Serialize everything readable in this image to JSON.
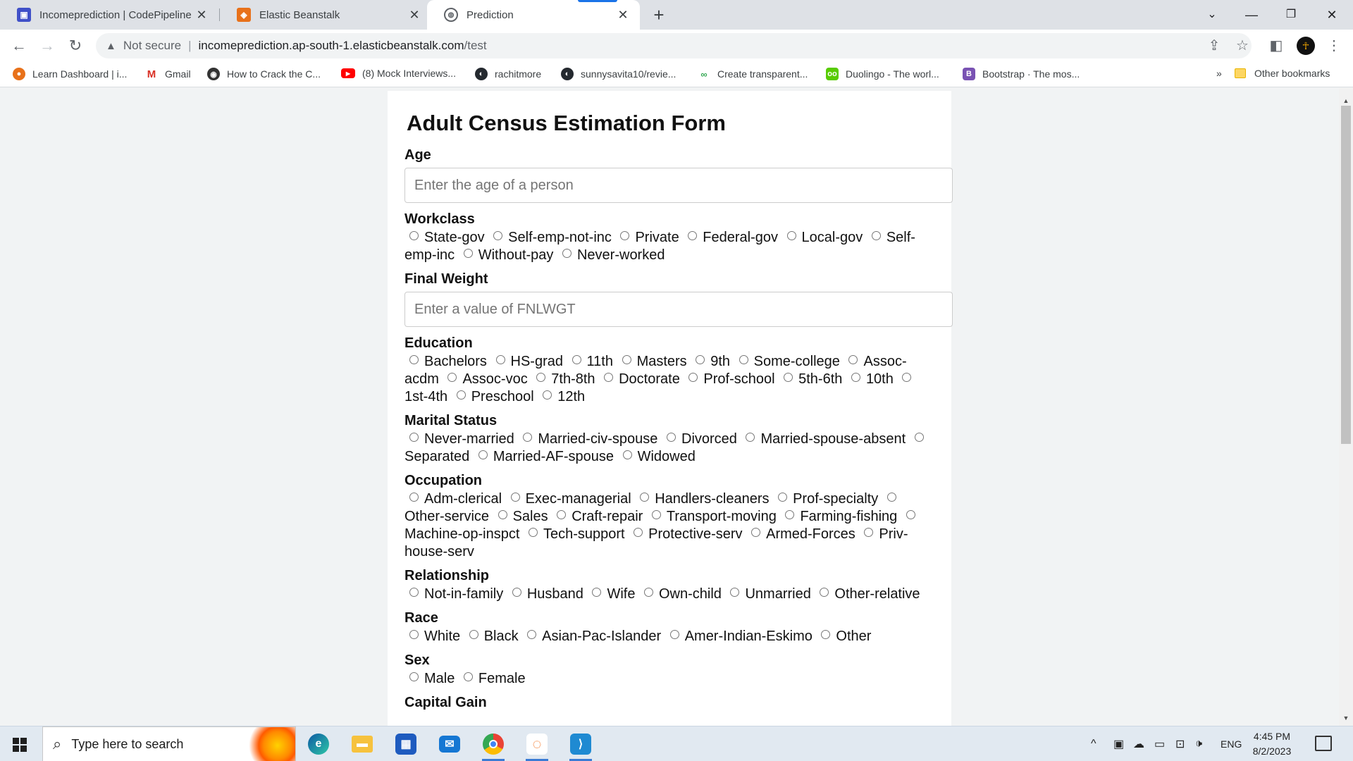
{
  "browser": {
    "tabs": [
      {
        "title": "Incomeprediction | CodePipeline",
        "icon": "codepipeline-icon",
        "color": "#4050c8"
      },
      {
        "title": "Elastic Beanstalk",
        "icon": "aws-icon",
        "color": "#e8711a"
      },
      {
        "title": "Prediction",
        "icon": "globe-icon",
        "color": "#5f6368"
      }
    ],
    "address": {
      "security": "Not secure",
      "host": "incomeprediction.ap-south-1.elasticbeanstalk.com",
      "path": "/test"
    },
    "bookmarks": [
      {
        "label": "Learn Dashboard | i...",
        "icon": "learn-icon",
        "color": "#e8711a"
      },
      {
        "label": "Gmail",
        "icon": "gmail-icon",
        "color": "#d93025"
      },
      {
        "label": "How to Crack the C...",
        "icon": "site-icon",
        "color": "#333333"
      },
      {
        "label": "(8) Mock Interviews...",
        "icon": "youtube-icon",
        "color": "#ff0000"
      },
      {
        "label": "rachitmore",
        "icon": "github-icon",
        "color": "#24292f"
      },
      {
        "label": "sunnysavita10/revie...",
        "icon": "github-icon",
        "color": "#24292f"
      },
      {
        "label": "Create transparent...",
        "icon": "link-icon",
        "color": "#34a853"
      },
      {
        "label": "Duolingo - The worl...",
        "icon": "duolingo-icon",
        "color": "#58cc02"
      },
      {
        "label": "Bootstrap · The mos...",
        "icon": "bootstrap-icon",
        "color": "#7952b3"
      }
    ],
    "overflow": "»",
    "other_bookmarks": "Other bookmarks"
  },
  "form": {
    "title": "Adult Census Estimation Form",
    "age_label": "Age",
    "age_placeholder": "Enter the age of a person",
    "workclass_label": "Workclass",
    "workclass_options": [
      "State-gov",
      "Self-emp-not-inc",
      "Private",
      "Federal-gov",
      "Local-gov",
      "Self-emp-inc",
      "Without-pay",
      "Never-worked"
    ],
    "fnlwgt_label": "Final Weight",
    "fnlwgt_placeholder": "Enter a value of FNLWGT",
    "education_label": "Education",
    "education_options": [
      "Bachelors",
      "HS-grad",
      "11th",
      "Masters",
      "9th",
      "Some-college",
      "Assoc-acdm",
      "Assoc-voc",
      "7th-8th",
      "Doctorate",
      "Prof-school",
      "5th-6th",
      "10th",
      "1st-4th",
      "Preschool",
      "12th"
    ],
    "marital_label": "Marital Status",
    "marital_options": [
      "Never-married",
      "Married-civ-spouse",
      "Divorced",
      "Married-spouse-absent",
      "Separated",
      "Married-AF-spouse",
      "Widowed"
    ],
    "occupation_label": "Occupation",
    "occupation_options": [
      "Adm-clerical",
      "Exec-managerial",
      "Handlers-cleaners",
      "Prof-specialty",
      "Other-service",
      "Sales",
      "Craft-repair",
      "Transport-moving",
      "Farming-fishing",
      "Machine-op-inspct",
      "Tech-support",
      "Protective-serv",
      "Armed-Forces",
      "Priv-house-serv"
    ],
    "relationship_label": "Relationship",
    "relationship_options": [
      "Not-in-family",
      "Husband",
      "Wife",
      "Own-child",
      "Unmarried",
      "Other-relative"
    ],
    "race_label": "Race",
    "race_options": [
      "White",
      "Black",
      "Asian-Pac-Islander",
      "Amer-Indian-Eskimo",
      "Other"
    ],
    "sex_label": "Sex",
    "sex_options": [
      "Male",
      "Female"
    ],
    "capital_gain_label": "Capital Gain"
  },
  "taskbar": {
    "search_placeholder": "Type here to search",
    "apps": [
      "edge-icon",
      "file-explorer-icon",
      "store-icon",
      "mail-icon",
      "chrome-icon",
      "jupyter-icon",
      "vscode-icon"
    ],
    "language": "ENG",
    "time": "4:45 PM",
    "date": "8/2/2023"
  }
}
